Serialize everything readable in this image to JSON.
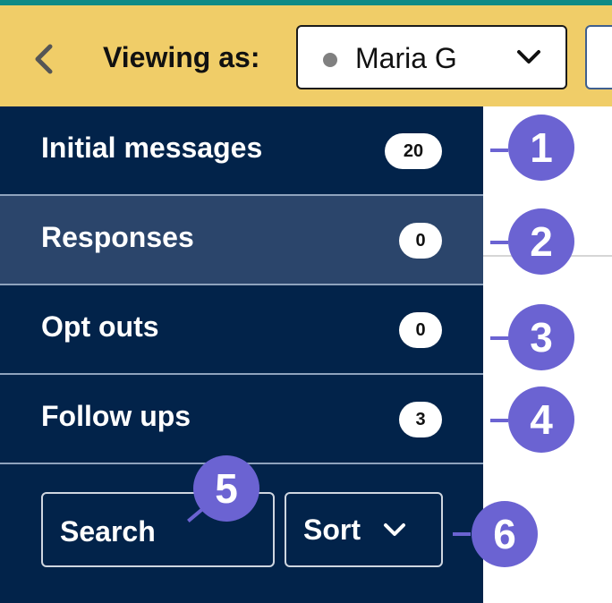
{
  "header": {
    "viewing_label": "Viewing as:",
    "selected_user": "Maria G",
    "status_dot_color": "#808080",
    "back_icon": "chevron-left-icon",
    "dropdown_icon": "chevron-down-icon"
  },
  "sidebar": {
    "items": [
      {
        "label": "Initial messages",
        "count": "20",
        "active": false
      },
      {
        "label": "Responses",
        "count": "0",
        "active": true
      },
      {
        "label": "Opt outs",
        "count": "0",
        "active": false
      },
      {
        "label": "Follow ups",
        "count": "3",
        "active": false
      }
    ],
    "search_label": "Search",
    "sort_label": "Sort"
  },
  "callouts": [
    "1",
    "2",
    "3",
    "4",
    "5",
    "6"
  ],
  "colors": {
    "header_bg": "#f0cd68",
    "top_stripe": "#0f8a86",
    "sidebar_bg": "#02234a",
    "active_item_bg": "#2b456b",
    "callout": "#6b63d2"
  }
}
